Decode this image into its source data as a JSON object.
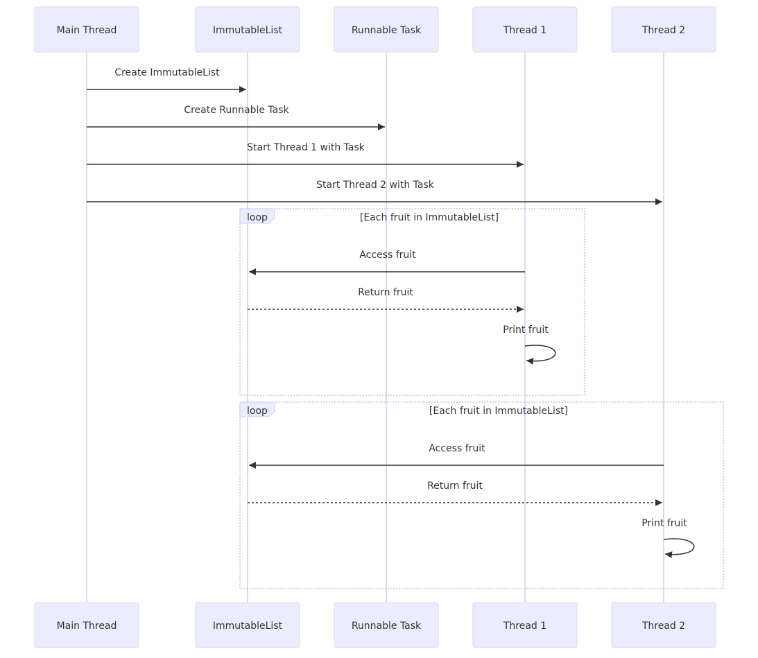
{
  "participants": [
    "Main Thread",
    "ImmutableList",
    "Runnable Task",
    "Thread 1",
    "Thread 2"
  ],
  "messages": [
    {
      "label": "Create ImmutableList",
      "from": "Main Thread",
      "to": "ImmutableList",
      "style": "solid"
    },
    {
      "label": "Create Runnable Task",
      "from": "Main Thread",
      "to": "Runnable Task",
      "style": "solid"
    },
    {
      "label": "Start Thread 1 with Task",
      "from": "Main Thread",
      "to": "Thread 1",
      "style": "solid"
    },
    {
      "label": "Start Thread 2 with Task",
      "from": "Main Thread",
      "to": "Thread 2",
      "style": "solid"
    }
  ],
  "loops": [
    {
      "keyword": "loop",
      "condition": "[Each fruit in ImmutableList]",
      "messages": [
        {
          "label": "Access fruit",
          "from": "Thread 1",
          "to": "ImmutableList",
          "style": "solid"
        },
        {
          "label": "Return fruit",
          "from": "ImmutableList",
          "to": "Thread 1",
          "style": "dotted"
        },
        {
          "label": "Print fruit",
          "from": "Thread 1",
          "to": "Thread 1",
          "style": "solid"
        }
      ]
    },
    {
      "keyword": "loop",
      "condition": "[Each fruit in ImmutableList]",
      "messages": [
        {
          "label": "Access fruit",
          "from": "Thread 2",
          "to": "ImmutableList",
          "style": "solid"
        },
        {
          "label": "Return fruit",
          "from": "ImmutableList",
          "to": "Thread 2",
          "style": "dotted"
        },
        {
          "label": "Print fruit",
          "from": "Thread 2",
          "to": "Thread 2",
          "style": "solid"
        }
      ]
    }
  ]
}
